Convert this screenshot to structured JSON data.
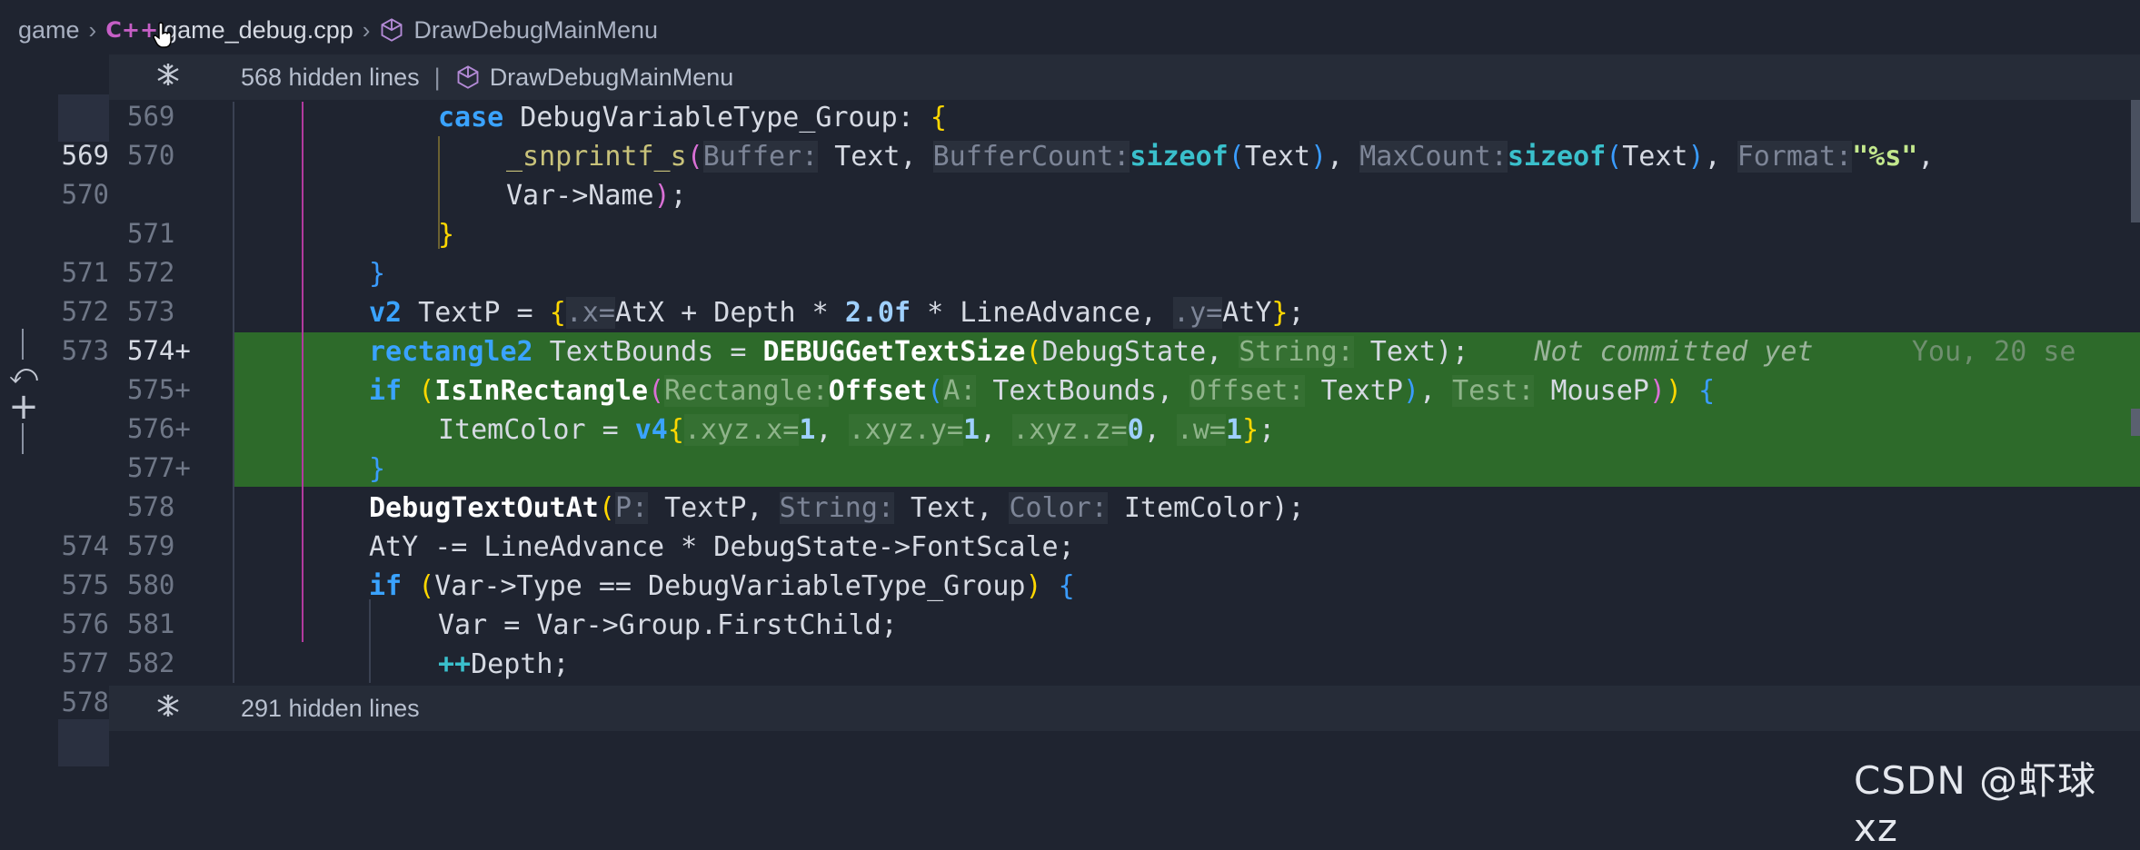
{
  "breadcrumb": {
    "folder": "game",
    "file_icon": "C++",
    "file": "game_debug.cpp",
    "symbol": "DrawDebugMainMenu"
  },
  "fold_top": {
    "label": "568 hidden lines",
    "symbol": "DrawDebugMainMenu"
  },
  "fold_bottom": {
    "label": "291 hidden lines"
  },
  "left_line_numbers": [
    "",
    "569",
    "570",
    "",
    "571",
    "572",
    "573",
    "",
    "",
    "",
    "",
    "574",
    "575",
    "576",
    "577",
    "578"
  ],
  "right_line_numbers": [
    "569",
    "570",
    "",
    "571",
    "572",
    "573",
    "574+",
    "575+",
    "576+",
    "577+",
    "578",
    "579",
    "580",
    "581",
    "582"
  ],
  "code": {
    "l569_kw": "case",
    "l569_rest": " DebugVariableType_Group: ",
    "l570_fn": "_snprintf_s",
    "l570_h1": "Buffer:",
    "l570_a1": " Text, ",
    "l570_h2": "BufferCount:",
    "l570_sizeof": "sizeof",
    "l570_a2": "Text",
    "l570_h3": "MaxCount:",
    "l570_h4": "Format:",
    "l570_fmt": "\"%s\"",
    "l570b": "Var->Name",
    "l573_type": "v2",
    "l573_rest": " TextP = ",
    "l573_h1": ".x=",
    "l573_mid": "AtX + Depth * ",
    "l573_num": "2.0f",
    "l573_mid2": " * LineAdvance, ",
    "l573_h2": ".y=",
    "l573_end": "AtY",
    "l574_type": "rectangle2",
    "l574_rest": " TextBounds = ",
    "l574_fn": "DEBUGGetTextSize",
    "l574_arg": "DebugState, ",
    "l574_h": "String:",
    "l574_arg2": " Text);",
    "blame": "Not committed yet",
    "blame2": "You, 20 se",
    "l575_if": "if",
    "l575_fn": "IsInRectangle",
    "l575_h1": "Rectangle:",
    "l575_fn2": "Offset",
    "l575_h2": "A:",
    "l575_a2": " TextBounds, ",
    "l575_h3": "Offset:",
    "l575_a3": " TextP",
    "l575_h4": "Test:",
    "l575_a4": " MouseP",
    "l576_a": "ItemColor = ",
    "l576_type": "v4",
    "l576_h1": ".xyz.x=",
    "l576_h2": ".xyz.y=",
    "l576_h3": ".xyz.z=",
    "l576_h4": ".w=",
    "l576_n1": "1",
    "l576_n2": "1",
    "l576_n3": "0",
    "l576_n4": "1",
    "l578_fn": "DebugTextOutAt",
    "l578_h1": "P:",
    "l578_a1": " TextP, ",
    "l578_h2": "String:",
    "l578_a2": " Text, ",
    "l578_h3": "Color:",
    "l578_a3": " ItemColor);",
    "l579": "AtY -= LineAdvance * DebugState->FontScale;",
    "l580_if": "if",
    "l580_rest": "Var->Type == DebugVariableType_Group",
    "l581": "Var = Var->Group.FirstChild;",
    "l582_op": "++",
    "l582_rest": "Depth;"
  },
  "diff_controls": {
    "revert": "⤺",
    "add": "+"
  },
  "watermark": "CSDN @虾球xz"
}
